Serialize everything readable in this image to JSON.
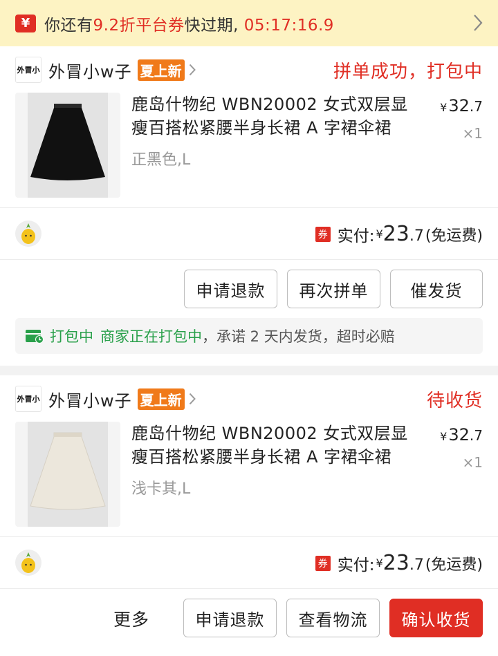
{
  "banner": {
    "icon": "¥",
    "text_prefix": "你还有",
    "text_highlight": "9.2折平台券",
    "text_middle": "快过期,",
    "countdown": "05:17:16.9"
  },
  "orders": [
    {
      "shop_logo_text": "外冒小",
      "shop_name": "外冒小w子",
      "shop_badge": "夏上新",
      "status": "拼单成功，打包中",
      "product_title": "鹿岛什物纪 WBN20002 女式双层显瘦百搭松紧腰半身长裙 A 字裙伞裙",
      "product_spec": "正黑色,L",
      "price_int": "32",
      "price_dec": ".7",
      "price_currency": "¥",
      "quantity": "×1",
      "coupon_tag": "券",
      "pay_label": "实付:",
      "pay_int": "23",
      "pay_dec": ".7",
      "pay_note": "(免运费)",
      "buttons": [
        "申请退款",
        "再次拼单",
        "催发货"
      ],
      "ship_status": "打包中",
      "ship_detail_green": "商家正在打包中",
      "ship_detail_gray": "，承诺 2 天内发货，超时必赔",
      "skirt_color": "#111111"
    },
    {
      "shop_logo_text": "外冒小",
      "shop_name": "外冒小w子",
      "shop_badge": "夏上新",
      "status": "待收货",
      "product_title": "鹿岛什物纪 WBN20002 女式双层显瘦百搭松紧腰半身长裙 A 字裙伞裙",
      "product_spec": "浅卡其,L",
      "price_int": "32",
      "price_dec": ".7",
      "price_currency": "¥",
      "quantity": "×1",
      "coupon_tag": "券",
      "pay_label": "实付:",
      "pay_int": "23",
      "pay_dec": ".7",
      "pay_note": "(免运费)",
      "more_label": "更多",
      "buttons": [
        "申请退款",
        "查看物流",
        "确认收货"
      ],
      "skirt_color": "#ece7dc"
    }
  ],
  "colors": {
    "accent_red": "#e02e24",
    "badge_orange": "#f07a1a",
    "ship_green": "#29a04a",
    "banner_bg": "#fdf3c3"
  }
}
